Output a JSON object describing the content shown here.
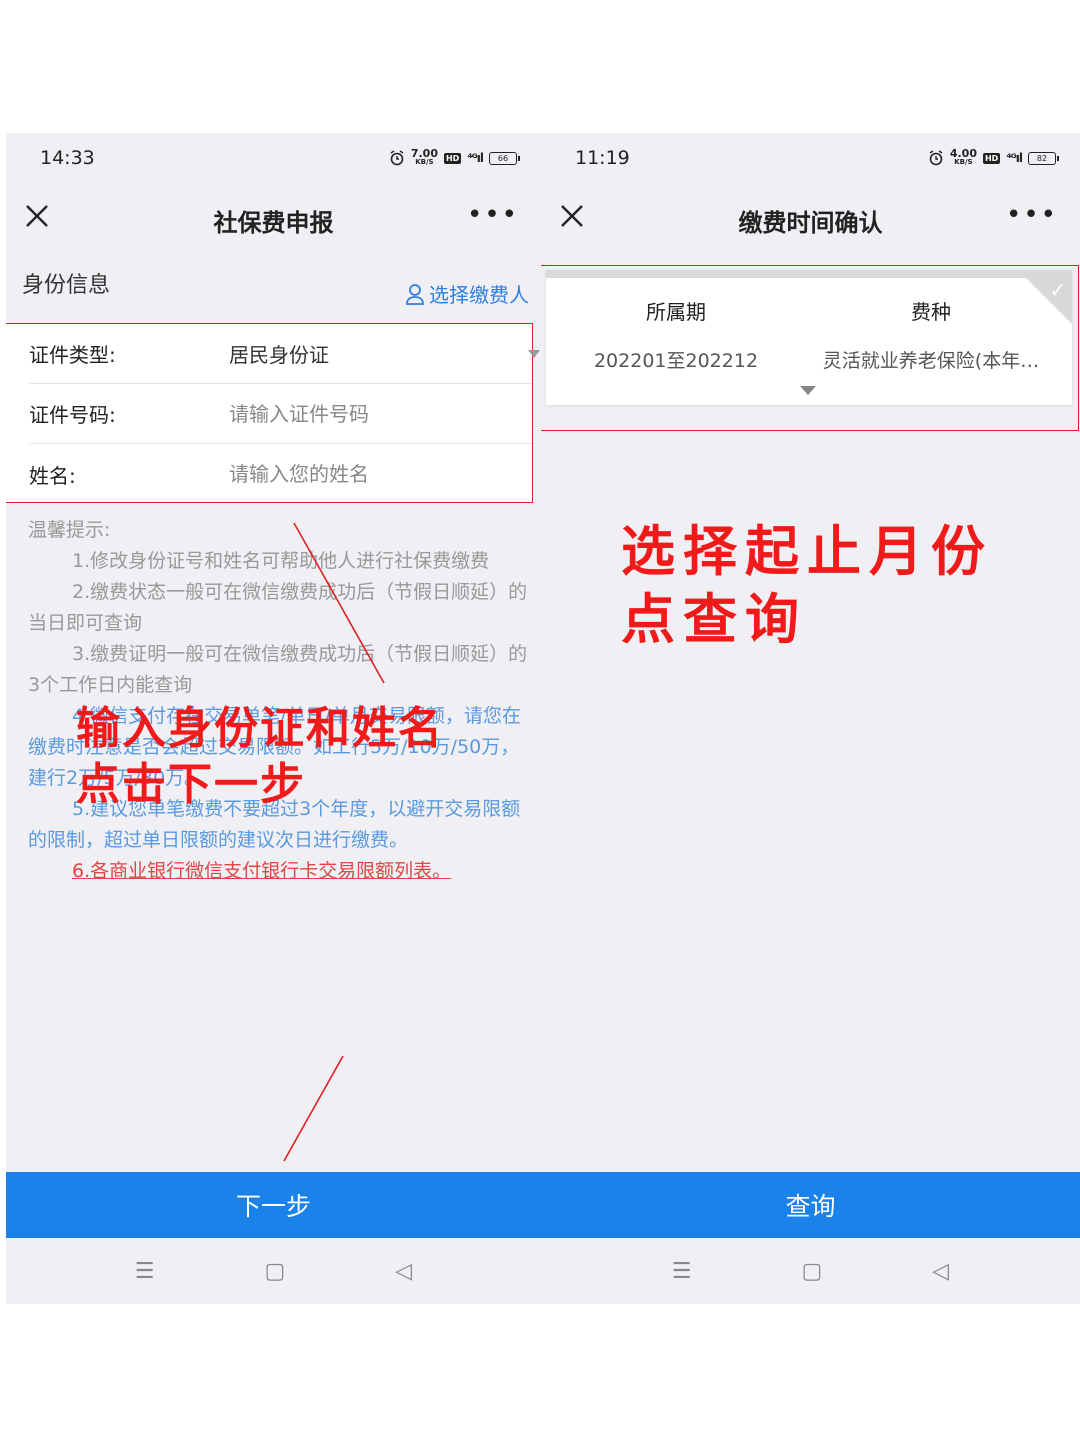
{
  "left": {
    "status": {
      "time": "14:33",
      "net_speed": "7.00",
      "net_unit": "KB/S",
      "hd": "HD",
      "signal": "⁴ᴳıl",
      "battery": "66"
    },
    "nav": {
      "title": "社保费申报",
      "more": "•••"
    },
    "section": {
      "title": "身份信息",
      "choose_payer": "选择缴费人"
    },
    "form": [
      {
        "label": "证件类型:",
        "value": "居民身份证"
      },
      {
        "label": "证件号码:",
        "placeholder": "请输入证件号码"
      },
      {
        "label": "姓名:",
        "placeholder": "请输入您的姓名"
      }
    ],
    "tips": {
      "heading": "温馨提示:",
      "items": [
        "1.修改身份证号和姓名可帮助他人进行社保费缴费",
        "2.缴费状态一般可在微信缴费成功后（节假日顺延）的当日即可查询",
        "3.缴费证明一般可在微信缴费成功后（节假日顺延）的3个工作日内能查询",
        "4.微信支付存在交易单笔/单日/单月交易限额，请您在缴费时注意是否会超过交易限额。如工行5万/10万/50万，建行2万/5万/30万。",
        "5.建议您单笔缴费不要超过3个年度，以避开交易限额的限制，超过单日限额的建议次日进行缴费。"
      ],
      "link": "6.各商业银行微信支付银行卡交易限额列表。"
    },
    "annotation": {
      "line1": "输入身份证和姓名",
      "line2": "点击下一步"
    },
    "button": "下一步"
  },
  "right": {
    "status": {
      "time": "11:19",
      "net_speed": "4.00",
      "net_unit": "KB/S",
      "hd": "HD",
      "signal": "⁴ᴳıl",
      "battery": "82"
    },
    "nav": {
      "title": "缴费时间确认",
      "more": "•••"
    },
    "table": {
      "headers": [
        "所属期",
        "费种"
      ],
      "row": [
        "202201至202212",
        "灵活就业养老保险(本年…"
      ]
    },
    "annotation": {
      "line1": "选择起止月份",
      "line2": "点查询"
    },
    "button": "查询"
  },
  "sys_nav": {
    "menu": "☰",
    "home": "▢",
    "back": "◁"
  },
  "colors": {
    "accent": "#1a82e9",
    "annotation_red": "#f01a1a",
    "link_blue": "#2d7fe3"
  }
}
